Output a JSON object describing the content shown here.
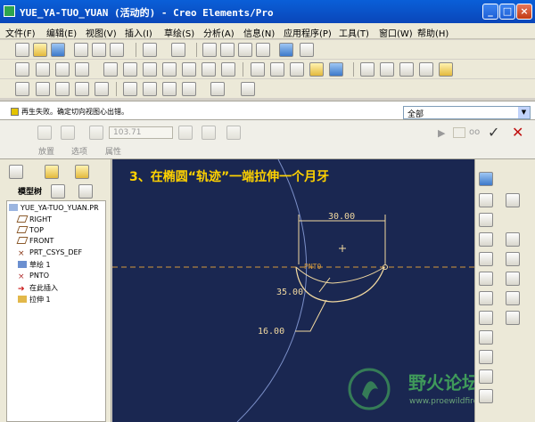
{
  "window": {
    "title": "YUE_YA-TUO_YUAN (活动的) - Creo Elements/Pro"
  },
  "menu": [
    "文件(F)",
    "编辑(E)",
    "视图(V)",
    "插入(I)",
    "草绘(S)",
    "分析(A)",
    "信息(N)",
    "应用程序(P)",
    "工具(T)",
    "窗口(W)",
    "帮助(H)"
  ],
  "message": {
    "text": "再生失败。确定切向视图心出错。"
  },
  "filter": {
    "value": "全部"
  },
  "dashboard": {
    "depth_value": "103.71",
    "tabs": [
      "放置",
      "选项",
      "属性"
    ]
  },
  "tree": {
    "title": "模型树",
    "nodes": [
      "YUE_YA-TUO_YUAN.PR",
      "RIGHT",
      "TOP",
      "FRONT",
      "PRT_CSYS_DEF",
      "草绘 1",
      "PNTO",
      "在此插入",
      "拉伸 1"
    ]
  },
  "graphics": {
    "caption": "3、在椭圆“轨迹”一端拉伸一个月牙",
    "dim_width": "30.00",
    "dim_radius_outer": "35.00",
    "dim_radius_inner": "16.00",
    "point_label": "PNT0"
  },
  "watermark": {
    "text": "野火论坛",
    "url": "www.proewildfire.cn"
  },
  "colors": {
    "graphics_bg": "#1a2751",
    "caption": "#ffd200",
    "sketch": "#f2d9a0",
    "datum": "#d69a3c"
  }
}
